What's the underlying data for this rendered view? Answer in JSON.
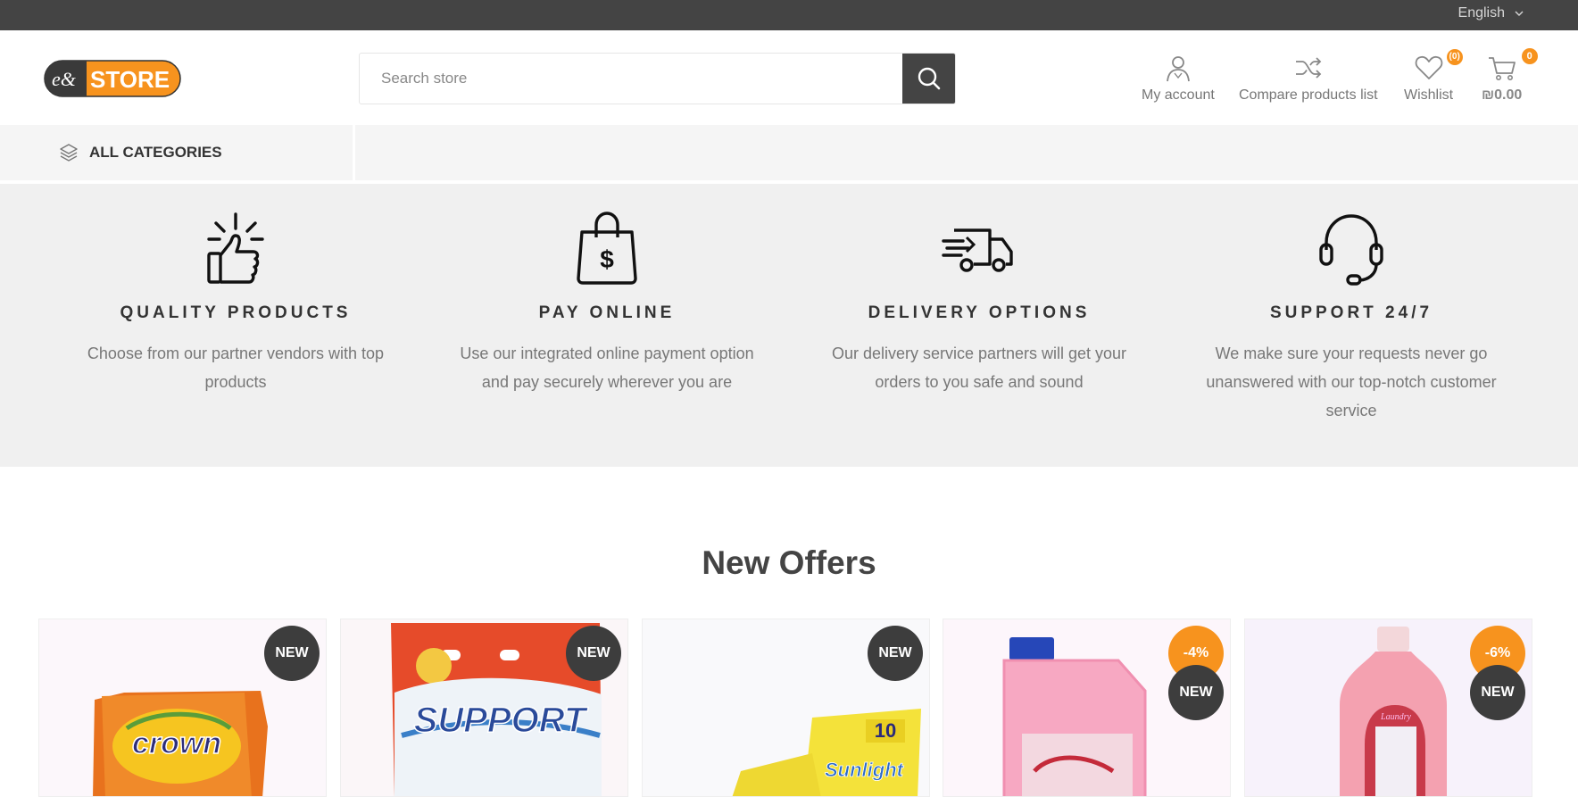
{
  "topbar": {
    "language": "English"
  },
  "header": {
    "logo_text": "STORE",
    "logo_mark": "e&",
    "search_placeholder": "Search store",
    "my_account": "My account",
    "compare": "Compare products list",
    "wishlist": "Wishlist",
    "wishlist_count": "(0)",
    "cart_count": "0",
    "cart_total": "₪0.00"
  },
  "nav": {
    "all_categories": "ALL CATEGORIES"
  },
  "features": [
    {
      "icon": "thumbs-up-icon",
      "title": "QUALITY PRODUCTS",
      "text": "Choose from our partner vendors with top products"
    },
    {
      "icon": "shopping-bag-dollar-icon",
      "title": "PAY ONLINE",
      "text": "Use our integrated online payment option and pay securely wherever you are"
    },
    {
      "icon": "delivery-truck-icon",
      "title": "DELIVERY OPTIONS",
      "text": "Our delivery service partners will get your orders to you safe and sound"
    },
    {
      "icon": "headset-icon",
      "title": "SUPPORT 24/7",
      "text": "We make sure your requests never go unanswered with our top-notch customer service"
    }
  ],
  "offers": {
    "title": "New Offers",
    "products": [
      {
        "badge": "NEW",
        "discount": "",
        "image_text": "crown"
      },
      {
        "badge": "NEW",
        "discount": "",
        "image_text": "SUPPORT"
      },
      {
        "badge": "NEW",
        "discount": "",
        "image_text": "Sunlight"
      },
      {
        "badge": "NEW",
        "discount": "-4%",
        "image_text": ""
      },
      {
        "badge": "NEW",
        "discount": "-6%",
        "image_text": "Laundry"
      }
    ]
  },
  "colors": {
    "accent": "#f7931e",
    "dark": "#444444"
  }
}
